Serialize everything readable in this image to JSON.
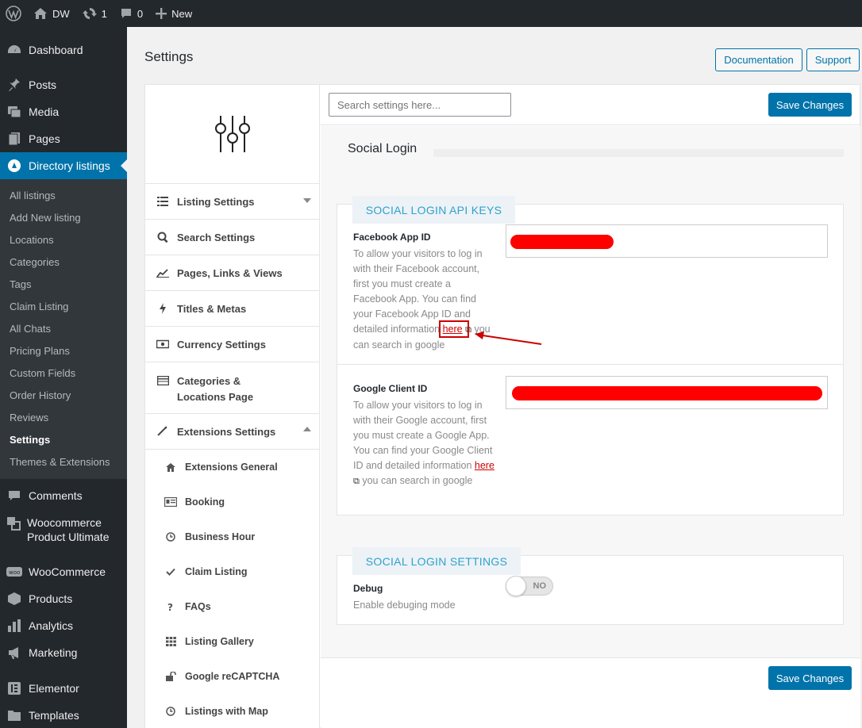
{
  "adminbar": {
    "site_name": "DW",
    "updates_count": "1",
    "comments_count": "0",
    "new_label": "New"
  },
  "sidebar": {
    "items_top": [
      {
        "label": "Dashboard",
        "icon": "dashboard-icon"
      },
      {
        "label": "Posts",
        "icon": "pin-icon"
      },
      {
        "label": "Media",
        "icon": "media-icon"
      },
      {
        "label": "Pages",
        "icon": "pages-icon"
      },
      {
        "label": "Directory listings",
        "icon": "directory-icon"
      }
    ],
    "submenu": [
      "All listings",
      "Add New listing",
      "Locations",
      "Categories",
      "Tags",
      "Claim Listing",
      "All Chats",
      "Pricing Plans",
      "Custom Fields",
      "Order History",
      "Reviews",
      "Settings",
      "Themes & Extensions"
    ],
    "items_bottom": [
      {
        "label": "Comments",
        "icon": "comment-icon"
      },
      {
        "label": "Woocommerce Product Ultimate",
        "icon": "woo-ultimate-icon"
      },
      {
        "label": "WooCommerce",
        "icon": "woocommerce-icon"
      },
      {
        "label": "Products",
        "icon": "box-icon"
      },
      {
        "label": "Analytics",
        "icon": "bar-chart-icon"
      },
      {
        "label": "Marketing",
        "icon": "megaphone-icon"
      },
      {
        "label": "Elementor",
        "icon": "elementor-icon"
      },
      {
        "label": "Templates",
        "icon": "folder-icon"
      }
    ]
  },
  "page": {
    "title": "Settings",
    "documentation_label": "Documentation",
    "support_label": "Support"
  },
  "settings_nav": {
    "items": [
      {
        "label": "Listing Settings",
        "icon": "list-icon"
      },
      {
        "label": "Search Settings",
        "icon": "search-icon"
      },
      {
        "label": "Pages, Links & Views",
        "icon": "line-chart-icon"
      },
      {
        "label": "Titles & Metas",
        "icon": "bolt-icon"
      },
      {
        "label": "Currency Settings",
        "icon": "money-icon"
      },
      {
        "label": "Categories & Locations Page",
        "icon": "table-icon"
      },
      {
        "label": "Extensions Settings",
        "icon": "magic-wand-icon"
      }
    ],
    "sub_items": [
      {
        "label": "Extensions General",
        "icon": "home-icon"
      },
      {
        "label": "Booking",
        "icon": "id-card-icon"
      },
      {
        "label": "Business Hour",
        "icon": "clock-icon"
      },
      {
        "label": "Claim Listing",
        "icon": "check-icon"
      },
      {
        "label": "FAQs",
        "icon": "question-icon"
      },
      {
        "label": "Listing Gallery",
        "icon": "grid-icon"
      },
      {
        "label": "Google reCAPTCHA",
        "icon": "unlock-icon"
      },
      {
        "label": "Listings with Map",
        "icon": "clock-icon"
      }
    ]
  },
  "main": {
    "search_placeholder": "Search settings here...",
    "save_label": "Save Changes",
    "section_title": "Social Login",
    "api_keys": {
      "tab_label": "SOCIAL LOGIN API KEYS",
      "facebook": {
        "label": "Facebook App ID",
        "desc": "To allow your visitors to log in with their Facebook account, first you must create a Facebook App. You can find your Facebook App ID and detailed information",
        "link": "here",
        "desc_tail": "you can search in google"
      },
      "google": {
        "label": "Google Client ID",
        "desc": "To allow your visitors to log in with their Google account, first you must create a Google App. You can find your Google Client ID and detailed information",
        "link": "here",
        "desc_tail": "you can search in google"
      }
    },
    "settings": {
      "tab_label": "SOCIAL LOGIN SETTINGS",
      "debug_label": "Debug",
      "debug_desc": "Enable debuging mode",
      "toggle_state": "NO"
    }
  },
  "colors": {
    "accent": "#0073aa",
    "sidebar_bg": "#23282d",
    "tab_text": "#2ea2cc",
    "redaction": "#ff0000",
    "annotation": "#cc0000"
  }
}
